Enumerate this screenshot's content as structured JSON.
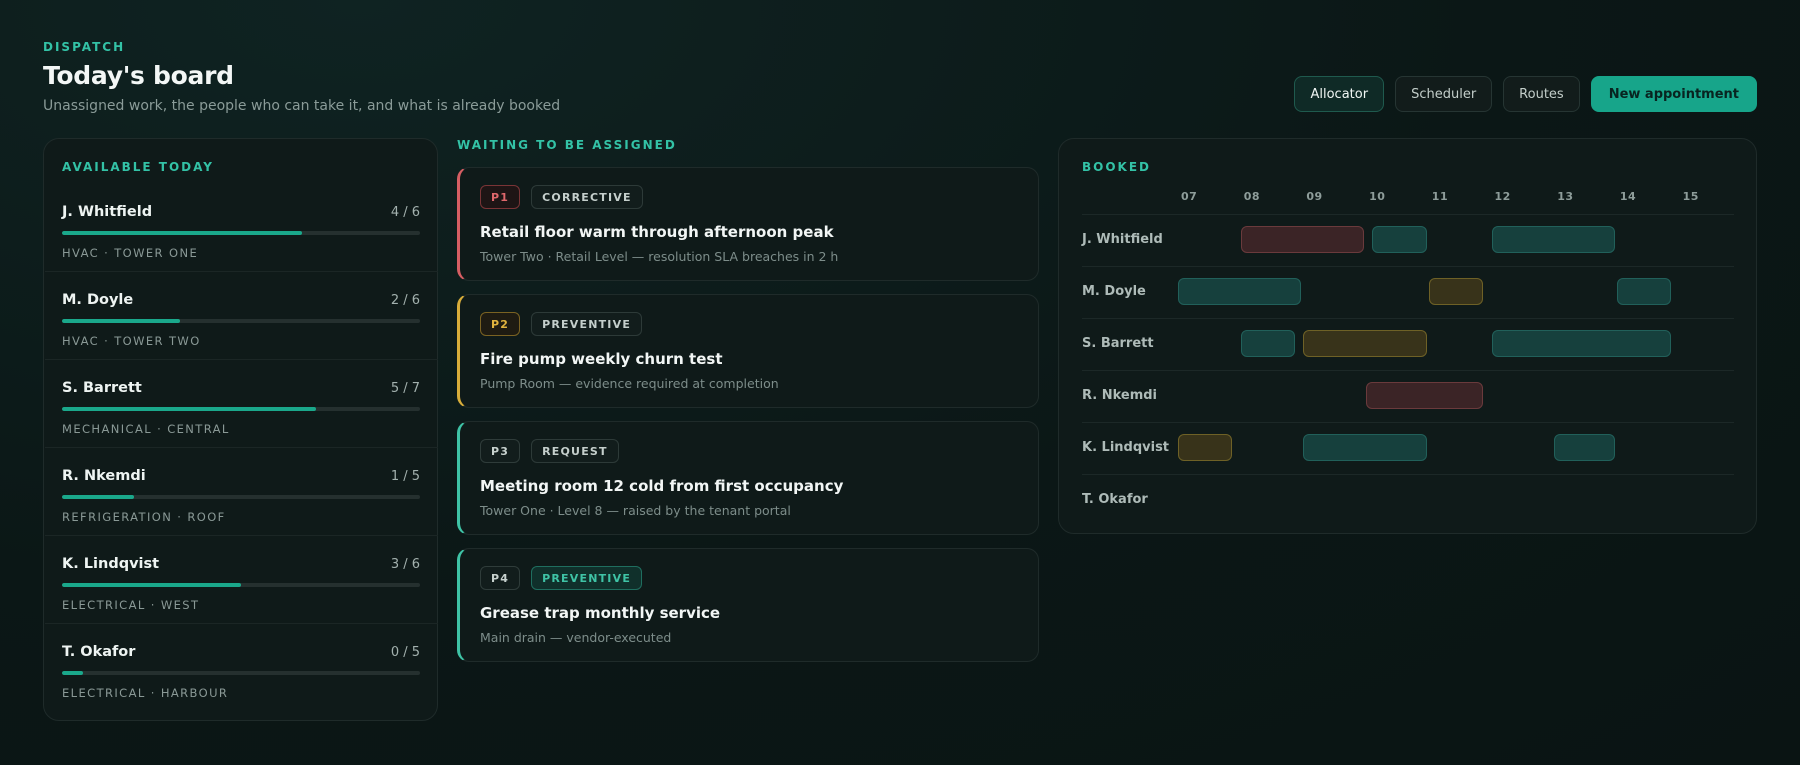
{
  "header": {
    "eyebrow": "DISPATCH",
    "title": "Today's board",
    "subtitle": "Unassigned work, the people who can take it, and what is already booked"
  },
  "actions": {
    "allocator": "Allocator",
    "scheduler": "Scheduler",
    "routes": "Routes",
    "new_appointment": "New appointment"
  },
  "available": {
    "title": "AVAILABLE TODAY",
    "techs": [
      {
        "name": "J. Whitfield",
        "load": "4 / 6",
        "fraction": 0.67,
        "skill": "HVAC · TOWER ONE"
      },
      {
        "name": "M. Doyle",
        "load": "2 / 6",
        "fraction": 0.33,
        "skill": "HVAC · TOWER TWO"
      },
      {
        "name": "S. Barrett",
        "load": "5 / 7",
        "fraction": 0.71,
        "skill": "MECHANICAL · CENTRAL"
      },
      {
        "name": "R. Nkemdi",
        "load": "1 / 5",
        "fraction": 0.2,
        "skill": "REFRIGERATION · ROOF"
      },
      {
        "name": "K. Lindqvist",
        "load": "3 / 6",
        "fraction": 0.5,
        "skill": "ELECTRICAL · WEST"
      },
      {
        "name": "T. Okafor",
        "load": "0 / 5",
        "fraction": 0.06,
        "skill": "ELECTRICAL · HARBOUR"
      }
    ]
  },
  "waiting": {
    "title": "WAITING TO BE ASSIGNED",
    "jobs": [
      {
        "priority": "P1",
        "type": "CORRECTIVE",
        "title": "Retail floor warm through afternoon peak",
        "meta": "Tower Two · Retail Level — resolution SLA breaches in 2 h",
        "accent": "#d65e63"
      },
      {
        "priority": "P2",
        "type": "PREVENTIVE",
        "title": "Fire pump weekly churn test",
        "meta": "Pump Room — evidence required at completion",
        "accent": "#d8ad3a"
      },
      {
        "priority": "P3",
        "type": "REQUEST",
        "title": "Meeting room 12 cold from first occupancy",
        "meta": "Tower One · Level 8 — raised by the tenant portal",
        "accent": "#3fc3a6"
      },
      {
        "priority": "P4",
        "type": "PREVENTIVE",
        "title": "Grease trap monthly service",
        "meta": "Main drain — vendor-executed",
        "accent": "#3fc3a6"
      }
    ]
  },
  "booked": {
    "title": "BOOKED",
    "hours": [
      "07",
      "08",
      "09",
      "10",
      "11",
      "12",
      "13",
      "14",
      "15"
    ],
    "rows": [
      {
        "name": "J. Whitfield",
        "appointments": [
          {
            "start": 8.0,
            "end": 10.0,
            "kind": "red"
          },
          {
            "start": 10.1,
            "end": 11.0,
            "kind": "teal"
          },
          {
            "start": 12.0,
            "end": 14.0,
            "kind": "teal"
          }
        ]
      },
      {
        "name": "M. Doyle",
        "appointments": [
          {
            "start": 7.0,
            "end": 9.0,
            "kind": "teal"
          },
          {
            "start": 11.0,
            "end": 11.9,
            "kind": "amber"
          },
          {
            "start": 14.0,
            "end": 14.9,
            "kind": "teal"
          }
        ]
      },
      {
        "name": "S. Barrett",
        "appointments": [
          {
            "start": 8.0,
            "end": 8.9,
            "kind": "teal"
          },
          {
            "start": 9.0,
            "end": 11.0,
            "kind": "amber"
          },
          {
            "start": 12.0,
            "end": 14.9,
            "kind": "teal"
          }
        ]
      },
      {
        "name": "R. Nkemdi",
        "appointments": [
          {
            "start": 10.0,
            "end": 11.9,
            "kind": "red"
          }
        ]
      },
      {
        "name": "K. Lindqvist",
        "appointments": [
          {
            "start": 7.0,
            "end": 7.9,
            "kind": "amber"
          },
          {
            "start": 9.0,
            "end": 11.0,
            "kind": "teal"
          },
          {
            "start": 13.0,
            "end": 14.0,
            "kind": "teal"
          }
        ]
      },
      {
        "name": "T. Okafor",
        "appointments": []
      }
    ]
  },
  "colors": {
    "accent": "#1aa88b",
    "p1": "#d65e63",
    "p2": "#d8ad3a",
    "p3": "#3fc3a6"
  }
}
